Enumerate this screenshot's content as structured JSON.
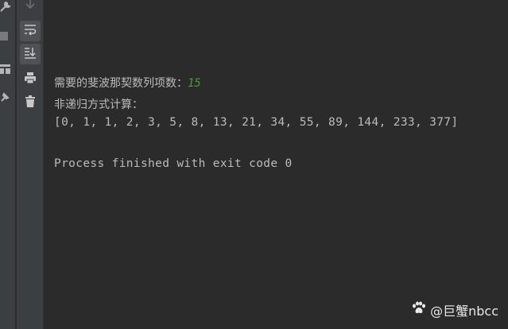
{
  "console": {
    "prompt_label": "需要的斐波那契数列项数：",
    "prompt_value": "15",
    "method_label": "非递归方式计算：",
    "result": "[0, 1, 1, 2, 3, 5, 8, 13, 21, 34, 55, 89, 144, 233, 377]",
    "finished": "Process finished with exit code 0"
  },
  "toolbar": {
    "icons": [
      "arrow-down-icon",
      "soft-wrap-icon",
      "scroll-to-end-icon",
      "print-icon",
      "trash-icon"
    ]
  },
  "left_gutter": {
    "icons": [
      "wrench-icon",
      "stop-icon",
      "layout-icon",
      "pin-icon"
    ]
  },
  "watermark": {
    "text": "@巨蟹nbcc"
  },
  "colors": {
    "background": "#2b2b2b",
    "toolbar": "#3c3f41",
    "text": "#bbbbbb",
    "input_value": "#4e9a3a"
  }
}
